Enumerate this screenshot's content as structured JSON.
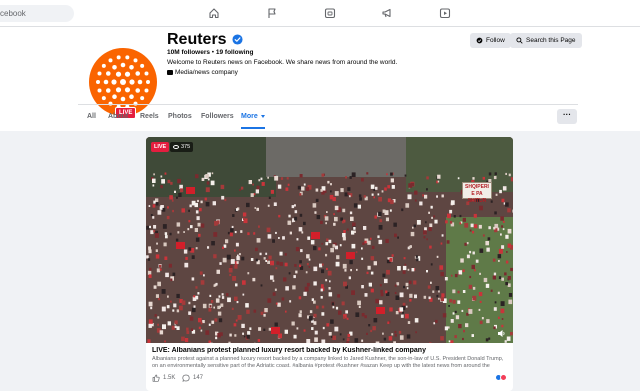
{
  "topbar": {
    "search_placeholder": "cebook",
    "icons": [
      "home-icon",
      "flag-icon",
      "marketplace-icon",
      "megaphone-icon",
      "gaming-icon"
    ]
  },
  "profile": {
    "name": "Reuters",
    "verified": true,
    "followers": "10M followers",
    "following": "19 following",
    "bio": "Welcome to Reuters news on Facebook. We share news from around the world.",
    "category": "Media/news company",
    "live_badge": "LIVE",
    "brand_color": "#fa6400"
  },
  "actions": {
    "follow_label": "Follow",
    "search_label": "Search this Page"
  },
  "tabs": [
    {
      "label": "All",
      "active": false
    },
    {
      "label": "About",
      "active": false
    },
    {
      "label": "Reels",
      "active": false
    },
    {
      "label": "Photos",
      "active": false
    },
    {
      "label": "Followers",
      "active": false
    },
    {
      "label": "More",
      "active": true
    }
  ],
  "more_menu_label": "···",
  "post": {
    "live_label": "LIVE",
    "view_count": "375",
    "sign_text": "SHQIPERI E PA SHITUR",
    "title": "LIVE: Albanians protest planned luxury resort backed by Kushner-linked company",
    "description": "Albanians protest against a planned luxury resort backed by a company linked to Jared Kushner, the son-in-law of U.S. President Donald Trump, on an environmentally sensitive part of the Adriatic coast. #albania #protest #kushner #sazan Keep up with the latest news from around the world...",
    "likes": "1.5K",
    "comments": "147",
    "accent_color": "#1b74e4"
  }
}
